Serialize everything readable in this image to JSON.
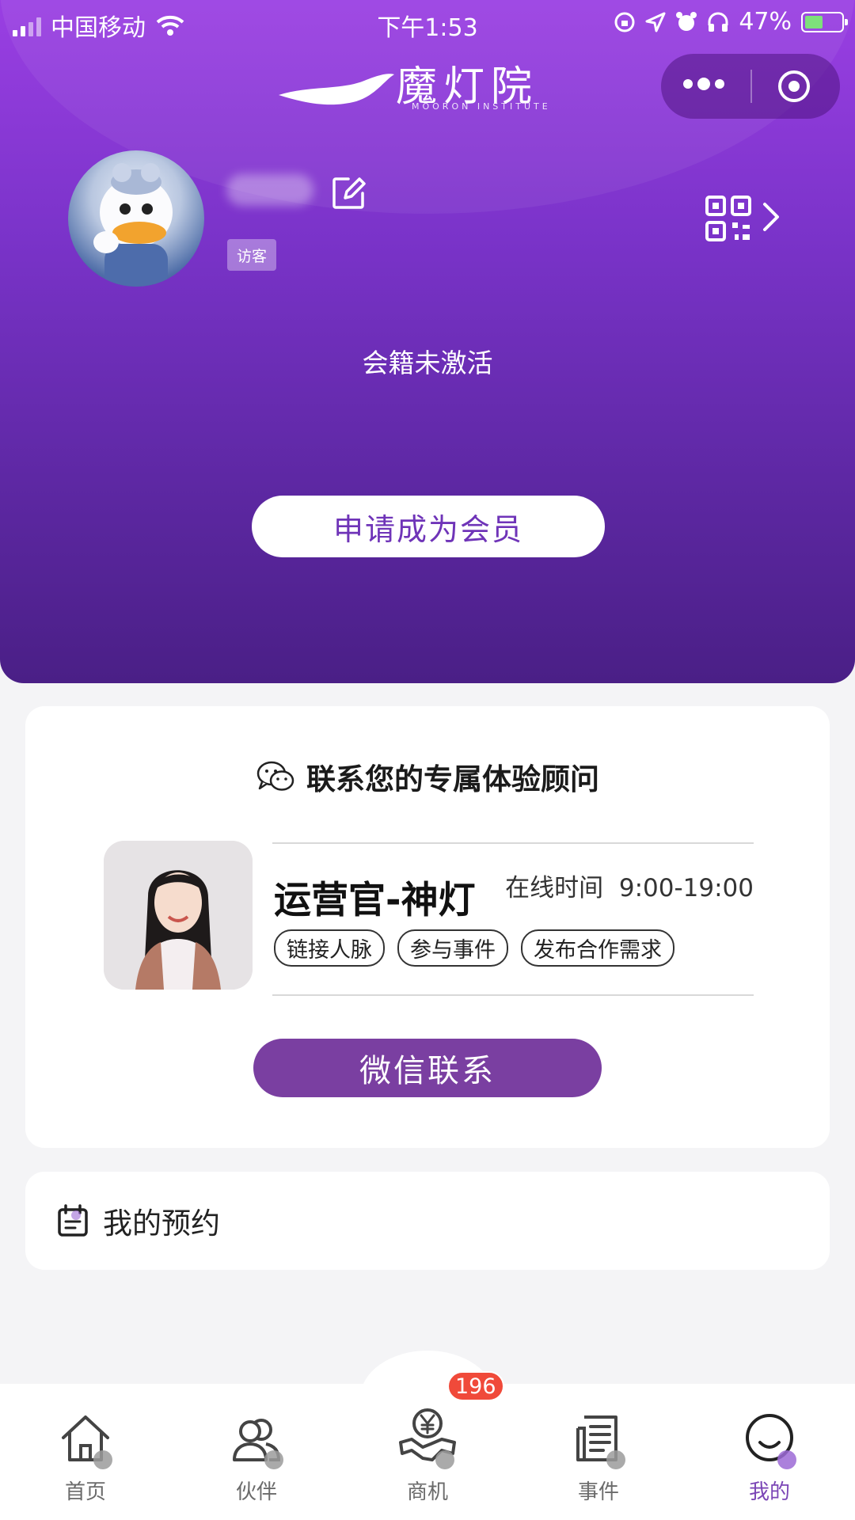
{
  "status_bar": {
    "carrier": "中国移动",
    "time": "下午1:53",
    "battery": "47%"
  },
  "brand": {
    "name": "魔灯院",
    "subtitle": "MOORON INSTITUTE"
  },
  "profile": {
    "role_badge": "访客",
    "membership_status": "会籍未激活",
    "apply_button": "申请成为会员"
  },
  "advisor_card": {
    "title": "联系您的专属体验顾问",
    "name": "运营官-神灯",
    "online_label": "在线时间",
    "online_hours": "9:00-19:00",
    "tags": [
      "链接人脉",
      "参与事件",
      "发布合作需求"
    ],
    "contact_button": "微信联系"
  },
  "reservations": {
    "label": "我的预约"
  },
  "tabbar": {
    "items": [
      {
        "label": "首页",
        "icon": "home-icon"
      },
      {
        "label": "伙伴",
        "icon": "partners-icon"
      },
      {
        "label": "商机",
        "icon": "business-opportunity-icon"
      },
      {
        "label": "事件",
        "icon": "events-icon"
      },
      {
        "label": "我的",
        "icon": "profile-icon"
      }
    ],
    "active_index": 4,
    "business_badge": "196"
  },
  "colors": {
    "brand_purple": "#7a33c9",
    "accent": "#7b46b6",
    "button_purple": "#7a3fa1",
    "badge_red": "#f04a3a"
  }
}
